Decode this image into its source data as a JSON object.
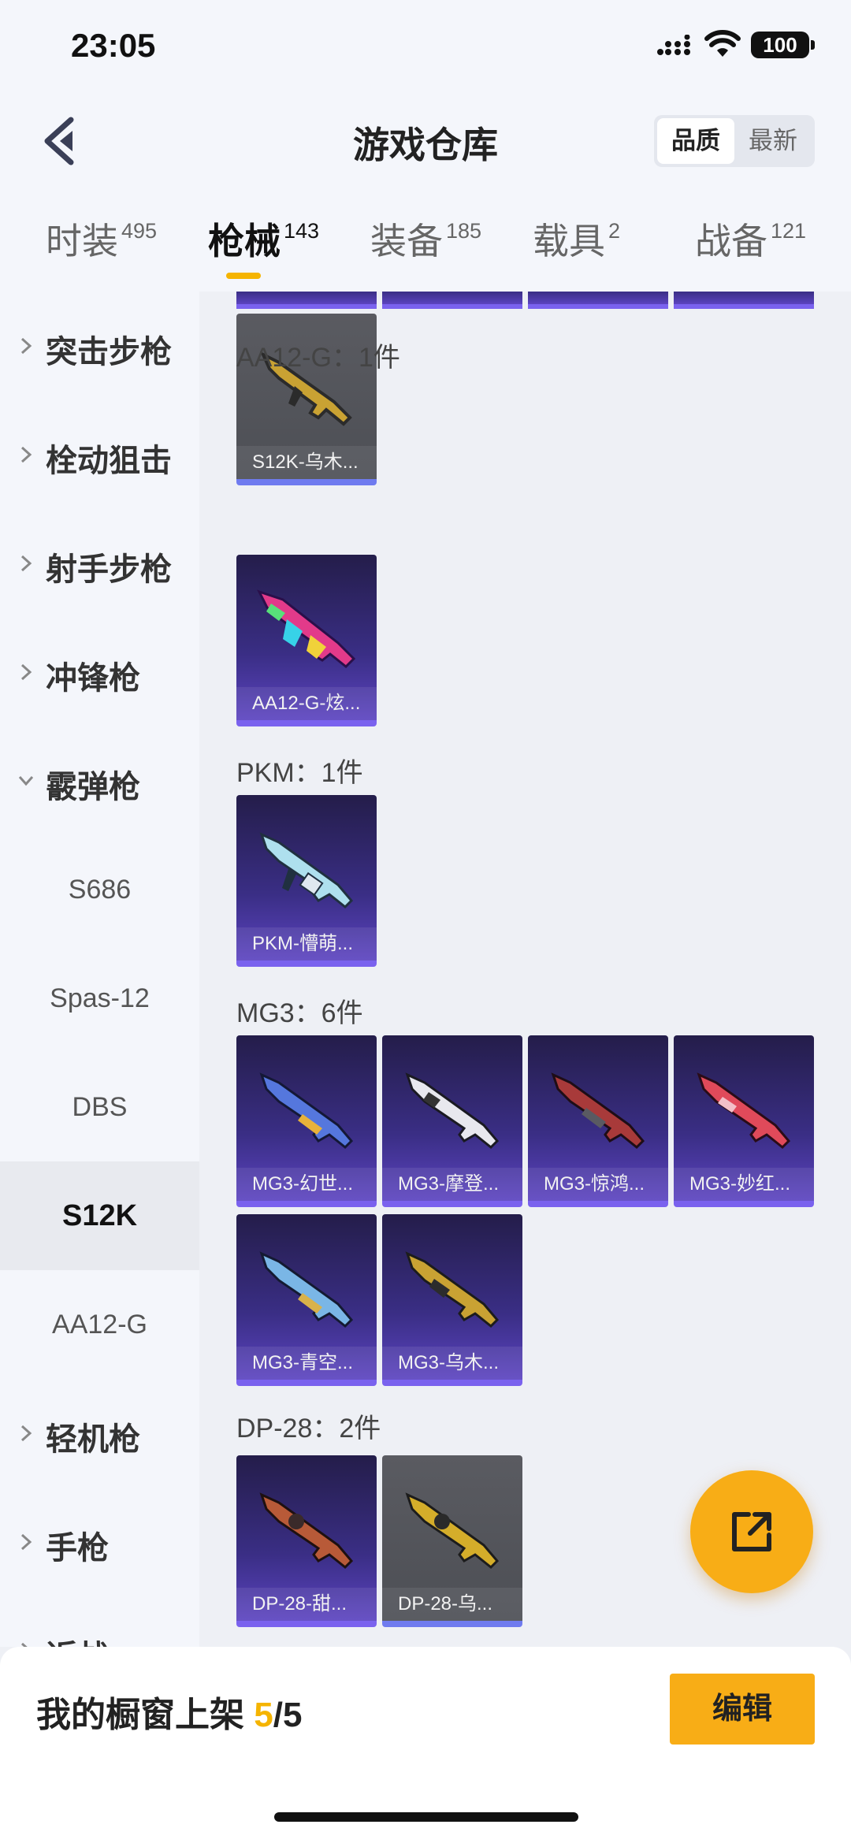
{
  "status_bar": {
    "time": "23:05",
    "battery": "100"
  },
  "header": {
    "title": "游戏仓库",
    "sort_options": [
      "品质",
      "最新"
    ],
    "sort_active": "品质"
  },
  "tabs": [
    {
      "label": "时装",
      "count": "495"
    },
    {
      "label": "枪械",
      "count": "143"
    },
    {
      "label": "装备",
      "count": "185"
    },
    {
      "label": "载具",
      "count": "2"
    },
    {
      "label": "战备",
      "count": "121"
    }
  ],
  "active_tab": "枪械",
  "sidebar": {
    "categories": [
      {
        "label": "突击步枪",
        "expanded": false
      },
      {
        "label": "栓动狙击",
        "expanded": false
      },
      {
        "label": "射手步枪",
        "expanded": false
      },
      {
        "label": "冲锋枪",
        "expanded": false
      },
      {
        "label": "霰弹枪",
        "expanded": true
      },
      {
        "label": "轻机枪",
        "expanded": false
      },
      {
        "label": "手枪",
        "expanded": false
      },
      {
        "label": "近战",
        "expanded": false
      }
    ],
    "subitems": [
      "S686",
      "Spas-12",
      "DBS",
      "S12K",
      "AA12-G"
    ],
    "selected_subitem": "S12K"
  },
  "groups": [
    {
      "name": "AA12-G：1件",
      "items": [
        "AA12-G-炫..."
      ]
    },
    {
      "name": "PKM：1件",
      "items": [
        "PKM-懵萌..."
      ]
    },
    {
      "name": "MG3：6件",
      "items": [
        "MG3-幻世...",
        "MG3-摩登...",
        "MG3-惊鸿...",
        "MG3-妙红...",
        "MG3-青空...",
        "MG3-乌木..."
      ]
    },
    {
      "name": "DP-28：2件",
      "items": [
        "DP-28-甜...",
        "DP-28-乌..."
      ]
    }
  ],
  "s12k_last_item": "S12K-乌木...",
  "bottom_bar": {
    "label_prefix": "我的橱窗上架 ",
    "current": "5",
    "total": "/5",
    "edit": "编辑"
  },
  "colors": {
    "accent": "#f5b400",
    "fab": "#f8ad16",
    "card_purple": "#3a2e85",
    "card_grey": "#55565c"
  }
}
